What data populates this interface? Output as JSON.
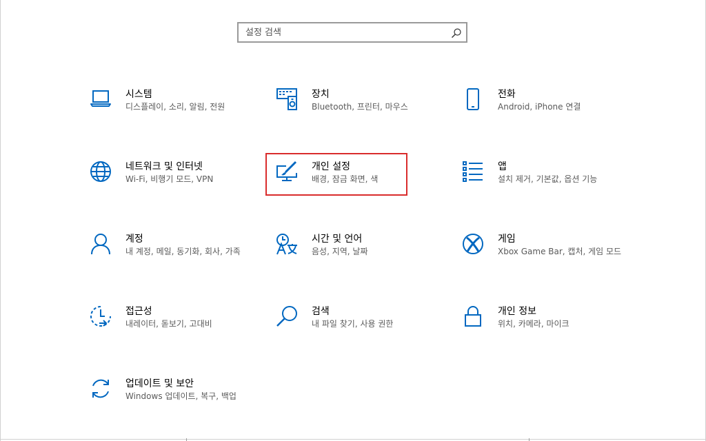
{
  "search": {
    "placeholder": "설정 검색",
    "value": ""
  },
  "colors": {
    "accent": "#0067c0",
    "highlight": "#d92b2b"
  },
  "tiles": [
    {
      "title": "시스템",
      "subtitle": "디스플레이, 소리, 알림, 전원",
      "icon": "laptop-icon"
    },
    {
      "title": "장치",
      "subtitle": "Bluetooth, 프린터, 마우스",
      "icon": "devices-icon"
    },
    {
      "title": "전화",
      "subtitle": "Android, iPhone 연결",
      "icon": "phone-icon"
    },
    {
      "title": "네트워크 및 인터넷",
      "subtitle": "Wi-Fi, 비행기 모드, VPN",
      "icon": "globe-icon"
    },
    {
      "title": "개인 설정",
      "subtitle": "배경, 잠금 화면, 색",
      "icon": "personalization-icon"
    },
    {
      "title": "앱",
      "subtitle": "설치 제거, 기본값, 옵션 기능",
      "icon": "apps-list-icon"
    },
    {
      "title": "계정",
      "subtitle": "내 계정, 메일, 동기화, 회사, 가족",
      "icon": "person-icon"
    },
    {
      "title": "시간 및 언어",
      "subtitle": "음성, 지역, 날짜",
      "icon": "time-language-icon"
    },
    {
      "title": "게임",
      "subtitle": "Xbox Game Bar, 캡처, 게임 모드",
      "icon": "xbox-icon"
    },
    {
      "title": "접근성",
      "subtitle": "내레이터, 돋보기, 고대비",
      "icon": "ease-of-access-icon"
    },
    {
      "title": "검색",
      "subtitle": "내 파일 찾기, 사용 권한",
      "icon": "search-magnifier-icon"
    },
    {
      "title": "개인 정보",
      "subtitle": "위치, 카메라, 마이크",
      "icon": "lock-icon"
    },
    {
      "title": "업데이트 및 보안",
      "subtitle": "Windows 업데이트, 복구, 백업",
      "icon": "sync-icon"
    }
  ]
}
